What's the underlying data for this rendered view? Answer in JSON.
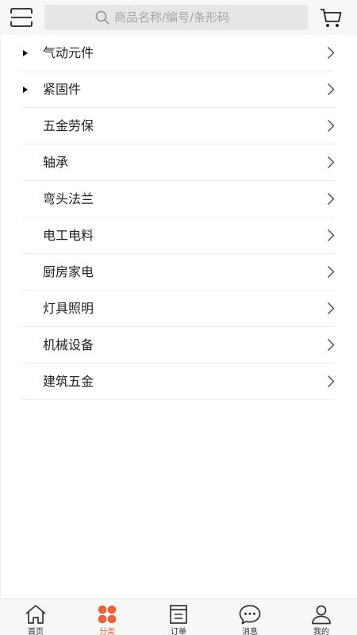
{
  "search": {
    "placeholder": "商品名称/编号/条形码",
    "value": ""
  },
  "header": {
    "scan_icon": "scan-icon",
    "cart_icon": "cart-icon"
  },
  "categories": [
    {
      "label": "气动元件",
      "expandable": true
    },
    {
      "label": "紧固件",
      "expandable": true
    },
    {
      "label": "五金劳保",
      "expandable": false
    },
    {
      "label": "轴承",
      "expandable": false
    },
    {
      "label": "弯头法兰",
      "expandable": false
    },
    {
      "label": "电工电料",
      "expandable": false
    },
    {
      "label": "厨房家电",
      "expandable": false
    },
    {
      "label": "灯具照明",
      "expandable": false
    },
    {
      "label": "机械设备",
      "expandable": false
    },
    {
      "label": "建筑五金",
      "expandable": false
    }
  ],
  "tabbar": {
    "active_index": 1,
    "active_color": "#f0603a",
    "items": [
      {
        "label": "首页",
        "icon": "home-icon"
      },
      {
        "label": "分类",
        "icon": "category-icon"
      },
      {
        "label": "订单",
        "icon": "order-icon"
      },
      {
        "label": "消息",
        "icon": "message-icon"
      },
      {
        "label": "我的",
        "icon": "profile-icon"
      }
    ]
  }
}
